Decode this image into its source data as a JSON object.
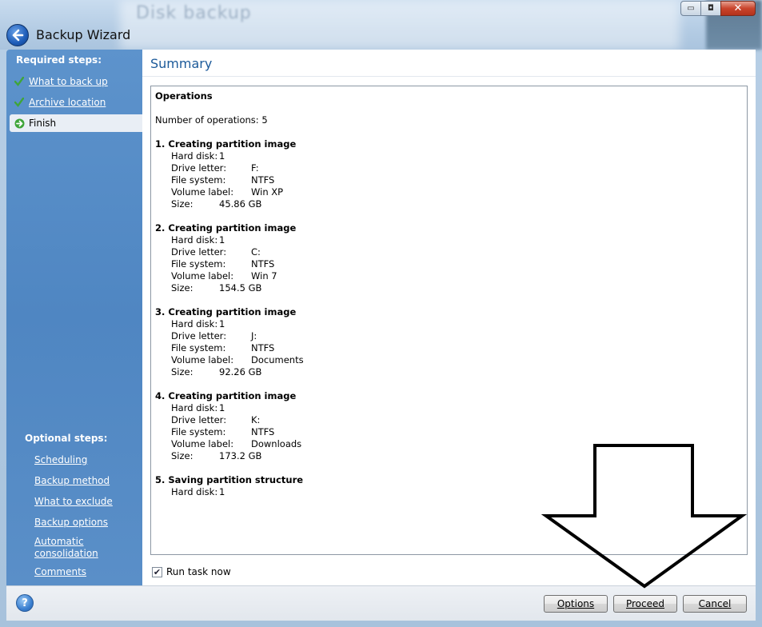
{
  "window": {
    "blurred_title": "Disk backup",
    "wizard_title": "Backup Wizard",
    "controls": {
      "minimize": "▭",
      "maximize": "◘",
      "close": "✕"
    }
  },
  "sidebar": {
    "required_heading": "Required steps:",
    "required_items": [
      {
        "label": "What to back up",
        "state": "done"
      },
      {
        "label": "Archive location",
        "state": "done"
      },
      {
        "label": "Finish",
        "state": "current"
      }
    ],
    "optional_heading": "Optional steps:",
    "optional_items": [
      {
        "label": "Scheduling"
      },
      {
        "label": "Backup method"
      },
      {
        "label": "What to exclude"
      },
      {
        "label": "Backup options"
      },
      {
        "label": "Automatic consolidation"
      },
      {
        "label": "Comments"
      }
    ]
  },
  "main": {
    "title": "Summary",
    "operations_heading": "Operations",
    "number_of_operations": "Number of operations: 5",
    "operations": [
      {
        "title": "1. Creating partition image",
        "fields": [
          {
            "key": "Hard disk:",
            "value": "1"
          },
          {
            "key": "Drive letter:",
            "value": "F:"
          },
          {
            "key": "File system:",
            "value": "NTFS"
          },
          {
            "key": "Volume label:",
            "value": "Win XP"
          },
          {
            "key": "Size:",
            "value": "45.86 GB"
          }
        ]
      },
      {
        "title": "2. Creating partition image",
        "fields": [
          {
            "key": "Hard disk:",
            "value": "1"
          },
          {
            "key": "Drive letter:",
            "value": "C:"
          },
          {
            "key": "File system:",
            "value": "NTFS"
          },
          {
            "key": "Volume label:",
            "value": "Win 7"
          },
          {
            "key": "Size:",
            "value": "154.5 GB"
          }
        ]
      },
      {
        "title": "3. Creating partition image",
        "fields": [
          {
            "key": "Hard disk:",
            "value": "1"
          },
          {
            "key": "Drive letter:",
            "value": "J:"
          },
          {
            "key": "File system:",
            "value": "NTFS"
          },
          {
            "key": "Volume label:",
            "value": "Documents"
          },
          {
            "key": "Size:",
            "value": "92.26 GB"
          }
        ]
      },
      {
        "title": "4. Creating partition image",
        "fields": [
          {
            "key": "Hard disk:",
            "value": "1"
          },
          {
            "key": "Drive letter:",
            "value": "K:"
          },
          {
            "key": "File system:",
            "value": "NTFS"
          },
          {
            "key": "Volume label:",
            "value": "Downloads"
          },
          {
            "key": "Size:",
            "value": "173.2 GB"
          }
        ]
      },
      {
        "title": "5. Saving partition structure",
        "fields": [
          {
            "key": "Hard disk:",
            "value": "1"
          }
        ]
      }
    ],
    "run_task_now": {
      "label": "Run task now",
      "checked": true
    }
  },
  "footer": {
    "help": "?",
    "options_label": "Options",
    "proceed_label": "Proceed",
    "cancel_label": "Cancel"
  },
  "colors": {
    "sidebar_blue": "#4f86c2",
    "title_blue": "#1c5a9a",
    "check_green": "#3fa53a"
  }
}
